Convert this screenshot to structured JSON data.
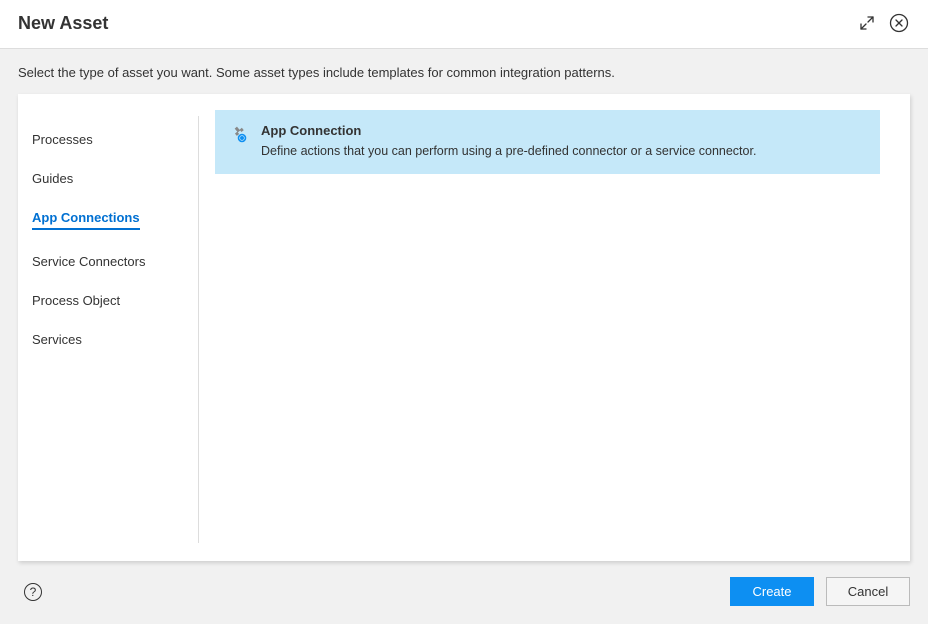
{
  "header": {
    "title": "New Asset"
  },
  "description": "Select the type of asset you want. Some asset types include templates for common integration patterns.",
  "sidebar": {
    "items": [
      {
        "label": "Processes",
        "active": false
      },
      {
        "label": "Guides",
        "active": false
      },
      {
        "label": "App Connections",
        "active": true
      },
      {
        "label": "Service Connectors",
        "active": false
      },
      {
        "label": "Process Object",
        "active": false
      },
      {
        "label": "Services",
        "active": false
      }
    ]
  },
  "content": {
    "asset": {
      "title": "App Connection",
      "description": "Define actions that you can perform using a pre-defined connector or a service connector."
    }
  },
  "footer": {
    "help": "?",
    "create_label": "Create",
    "cancel_label": "Cancel"
  }
}
